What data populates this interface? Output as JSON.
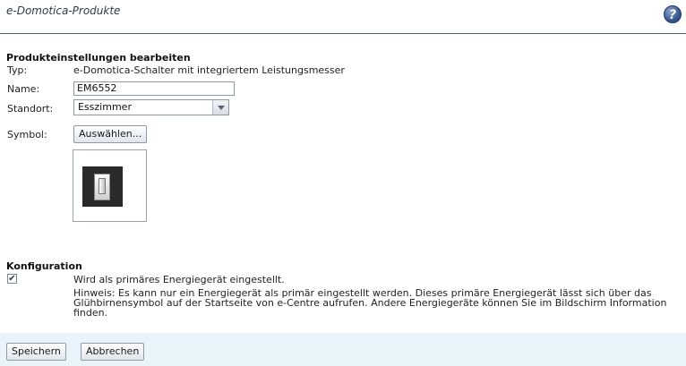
{
  "header": {
    "title": "e-Domotica-Produkte",
    "help_label": "?"
  },
  "product_settings": {
    "section_title": "Produkteinstellungen bearbeiten",
    "type_label": "Typ:",
    "type_value": "e-Domotica-Schalter mit integriertem Leistungsmesser",
    "name_label": "Name:",
    "name_value": "EM6552",
    "location_label": "Standort:",
    "location_value": "Esszimmer",
    "symbol_label": "Symbol:",
    "select_button_label": "Auswählen...",
    "symbol_icon": "light-switch-icon"
  },
  "configuration": {
    "section_title": "Konfiguration",
    "primary_checkbox_checked": true,
    "checkmark": "✔",
    "primary_label": "Wird als primäres Energiegerät eingestellt.",
    "hint_text": "Hinweis: Es kann nur ein Energiegerät als primär eingestellt werden. Dieses primäre Energiegerät lässt sich über das Glühbirnensymbol auf der Startseite von e-Centre aufrufen. Andere Energiegeräte können Sie im Bildschirm Information finden."
  },
  "footer": {
    "save_label": "Speichern",
    "cancel_label": "Abbrechen"
  }
}
